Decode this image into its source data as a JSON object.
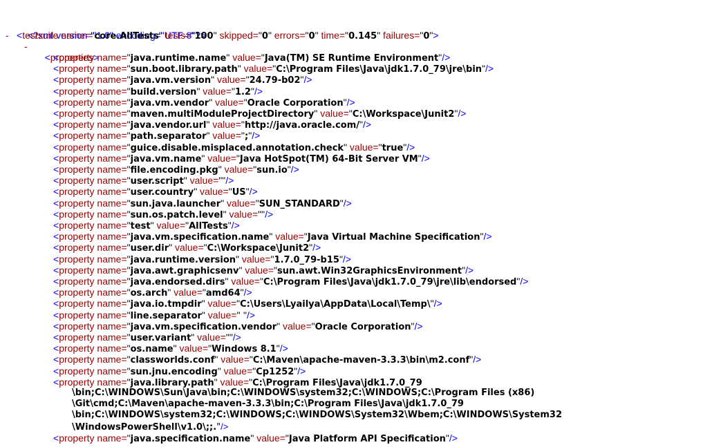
{
  "xml_decl": "<?xml version=\"1.0\" encoding=\"UTF-8\"?>",
  "toggle_symbol": "-",
  "testsuite": {
    "tag": "testsuite",
    "attrs": [
      {
        "name": "name",
        "value": "core.AllTests"
      },
      {
        "name": "tests",
        "value": "100"
      },
      {
        "name": "skipped",
        "value": "0"
      },
      {
        "name": "errors",
        "value": "0"
      },
      {
        "name": "time",
        "value": "0.145"
      },
      {
        "name": "failures",
        "value": "0"
      }
    ]
  },
  "properties_tag": "properties",
  "property_tag": "property",
  "attr_name": "name",
  "attr_value": "value",
  "properties": [
    {
      "name": "java.runtime.name",
      "value": "Java(TM) SE Runtime Environment"
    },
    {
      "name": "sun.boot.library.path",
      "value": "C:\\Program Files\\Java\\jdk1.7.0_79\\jre\\bin"
    },
    {
      "name": "java.vm.version",
      "value": "24.79-b02"
    },
    {
      "name": "build.version",
      "value": "1.2"
    },
    {
      "name": "java.vm.vendor",
      "value": "Oracle Corporation"
    },
    {
      "name": "maven.multiModuleProjectDirectory",
      "value": "C:\\Workspace\\Junit2"
    },
    {
      "name": "java.vendor.url",
      "value": "http://java.oracle.com/"
    },
    {
      "name": "path.separator",
      "value": ";"
    },
    {
      "name": "guice.disable.misplaced.annotation.check",
      "value": "true"
    },
    {
      "name": "java.vm.name",
      "value": "Java HotSpot(TM) 64-Bit Server VM"
    },
    {
      "name": "file.encoding.pkg",
      "value": "sun.io"
    },
    {
      "name": "user.script",
      "value": ""
    },
    {
      "name": "user.country",
      "value": "US"
    },
    {
      "name": "sun.java.launcher",
      "value": "SUN_STANDARD"
    },
    {
      "name": "sun.os.patch.level",
      "value": ""
    },
    {
      "name": "test",
      "value": "AllTests"
    },
    {
      "name": "java.vm.specification.name",
      "value": "Java Virtual Machine Specification"
    },
    {
      "name": "user.dir",
      "value": "C:\\Workspace\\Junit2"
    },
    {
      "name": "java.runtime.version",
      "value": "1.7.0_79-b15"
    },
    {
      "name": "java.awt.graphicsenv",
      "value": "sun.awt.Win32GraphicsEnvironment"
    },
    {
      "name": "java.endorsed.dirs",
      "value": "C:\\Program Files\\Java\\jdk1.7.0_79\\jre\\lib\\endorsed"
    },
    {
      "name": "os.arch",
      "value": "amd64"
    },
    {
      "name": "java.io.tmpdir",
      "value": "C:\\Users\\Lyailya\\AppData\\Local\\Temp\\"
    },
    {
      "name": "line.separator",
      "value": " "
    },
    {
      "name": "java.vm.specification.vendor",
      "value": "Oracle Corporation"
    },
    {
      "name": "user.variant",
      "value": ""
    },
    {
      "name": "os.name",
      "value": "Windows 8.1"
    },
    {
      "name": "classworlds.conf",
      "value": "C:\\Maven\\apache-maven-3.3.3\\bin\\m2.conf"
    },
    {
      "name": "sun.jnu.encoding",
      "value": "Cp1252"
    },
    {
      "name": "java.library.path",
      "value": "C:\\Program Files\\Java\\jdk1.7.0_79",
      "continuation": [
        "\\bin;C:\\WINDOWS\\Sun\\Java\\bin;C:\\WINDOWS\\system32;C:\\WINDOWS;C:\\Program Files (x86)",
        "\\Git\\cmd;C:\\Maven\\apache-maven-3.3.3\\bin;C:\\Program Files\\Java\\jdk1.7.0_79",
        "\\bin;C:\\WINDOWS\\system32;C:\\WINDOWS;C:\\WINDOWS\\System32\\Wbem;C:\\WINDOWS\\System32",
        "\\WindowsPowerShell\\v1.0\\;;."
      ]
    },
    {
      "name": "java.specification.name",
      "value": "Java Platform API Specification"
    }
  ]
}
